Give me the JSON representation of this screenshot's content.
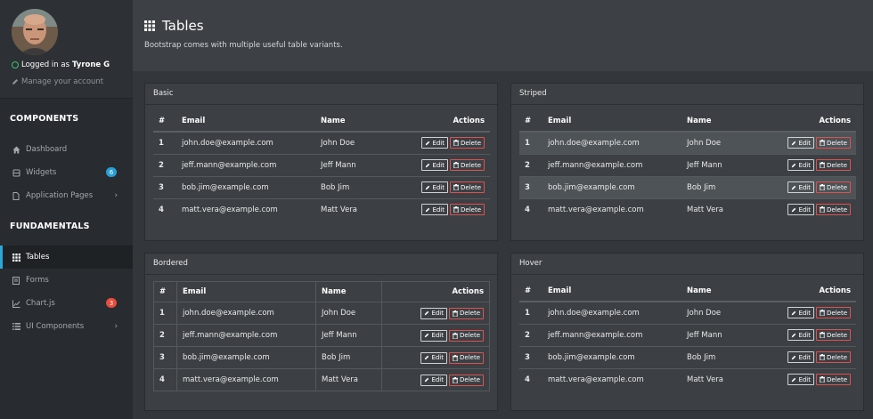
{
  "user": {
    "logged_prefix": "Logged in as",
    "name": "Tyrone G",
    "manage": "Manage your account"
  },
  "sidebar": {
    "components_title": "COMPONENTS",
    "fundamentals_title": "FUNDAMENTALS",
    "items": [
      {
        "label": "Dashboard",
        "icon": "home-icon"
      },
      {
        "label": "Widgets",
        "icon": "widgets-icon",
        "badge": "6"
      },
      {
        "label": "Application Pages",
        "icon": "page-icon"
      },
      {
        "label": "Tables",
        "icon": "grid-icon",
        "active": true
      },
      {
        "label": "Forms",
        "icon": "form-icon"
      },
      {
        "label": "Chart.js",
        "icon": "chart-icon",
        "badge": "3"
      },
      {
        "label": "UI Components",
        "icon": "list-icon"
      }
    ]
  },
  "colors": {
    "accent": "#2da7d6",
    "badge_blue": "#2a9fd6",
    "badge_red": "#e74c3c",
    "delete": "#d9534f",
    "online": "#38c172"
  },
  "page": {
    "title": "Tables",
    "subtitle": "Bootstrap comes with multiple useful table variants."
  },
  "table_headers": {
    "num": "#",
    "email": "Email",
    "name": "Name",
    "actions": "Actions"
  },
  "buttons": {
    "edit": "Edit",
    "delete": "Delete"
  },
  "cards": [
    {
      "title": "Basic",
      "variant": "basic"
    },
    {
      "title": "Striped",
      "variant": "striped"
    },
    {
      "title": "Bordered",
      "variant": "bordered"
    },
    {
      "title": "Hover",
      "variant": "hover"
    }
  ],
  "rows": [
    {
      "num": "1",
      "email": "john.doe@example.com",
      "name": "John Doe"
    },
    {
      "num": "2",
      "email": "jeff.mann@example.com",
      "name": "Jeff Mann"
    },
    {
      "num": "3",
      "email": "bob.jim@example.com",
      "name": "Bob Jim"
    },
    {
      "num": "4",
      "email": "matt.vera@example.com",
      "name": "Matt Vera"
    }
  ]
}
